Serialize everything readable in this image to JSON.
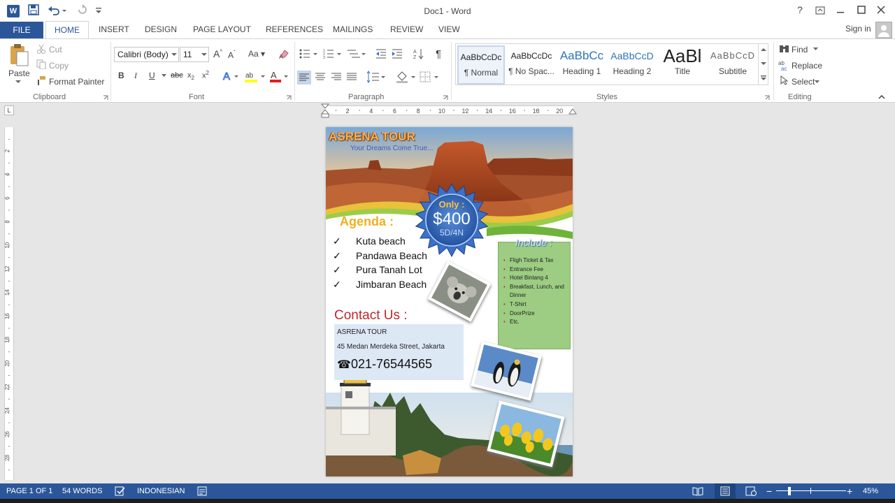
{
  "window": {
    "title": "Doc1 - Word",
    "app_icon": "W",
    "qat": {
      "save_icon": "save-icon",
      "undo_icon": "undo-icon",
      "redo_icon": "redo-icon",
      "customize_icon": "customize-icon"
    },
    "buttons": {
      "help": "?",
      "ribbon_display": "ribbon-display-icon",
      "minimize": "minimize-icon",
      "maximize": "maximize-icon",
      "close": "close-icon"
    }
  },
  "tabs": {
    "file": "FILE",
    "items": [
      "HOME",
      "INSERT",
      "DESIGN",
      "PAGE LAYOUT",
      "REFERENCES",
      "MAILINGS",
      "REVIEW",
      "VIEW"
    ],
    "active": "HOME",
    "sign_in": "Sign in"
  },
  "ribbon": {
    "clipboard": {
      "label": "Clipboard",
      "paste": "Paste",
      "cut": "Cut",
      "copy": "Copy",
      "format_painter": "Format Painter"
    },
    "font": {
      "label": "Font",
      "family": "Calibri (Body)",
      "size": "11",
      "aa": "Aa"
    },
    "paragraph": {
      "label": "Paragraph"
    },
    "styles": {
      "label": "Styles",
      "items": [
        {
          "preview": "AaBbCcDc",
          "name": "¶ Normal"
        },
        {
          "preview": "AaBbCcDc",
          "name": "¶ No Spac..."
        },
        {
          "preview": "AaBbCc",
          "name": "Heading 1"
        },
        {
          "preview": "AaBbCcD",
          "name": "Heading 2"
        },
        {
          "preview": "AaBl",
          "name": "Title"
        },
        {
          "preview": "AaBbCcD",
          "name": "Subtitle"
        }
      ]
    },
    "editing": {
      "label": "Editing",
      "find": "Find",
      "replace": "Replace",
      "select": "Select"
    }
  },
  "ruler": {
    "h_ticks": [
      "2",
      "4",
      "6",
      "8",
      "10",
      "12",
      "14",
      "16",
      "18",
      "20"
    ],
    "v_ticks": [
      "2",
      "4",
      "6",
      "8",
      "10",
      "12",
      "14",
      "16",
      "18",
      "20",
      "22",
      "24",
      "26",
      "28"
    ]
  },
  "document": {
    "title": "ASRENA TOUR",
    "tagline": "Your Dreams Come True...",
    "price_only": "Only :",
    "price": "$400",
    "duration": "5D/4N",
    "agenda_heading": "Agenda :",
    "agenda_items": [
      "Kuta beach",
      "Pandawa Beach",
      "Pura Tanah Lot",
      "Jimbaran Beach"
    ],
    "include_heading": "Include :",
    "include_items": [
      "Fligh Ticket & Tax",
      "Entrance Fee",
      "Hotel Bintang 4",
      "Breakfast, Lunch, and Dinner",
      "T-Shirt",
      "DoorPrize",
      "Etc."
    ],
    "contact_heading": "Contact Us :",
    "contact_name": "ASRENA TOUR",
    "contact_address": "45 Medan Merdeka Street, Jakarta",
    "contact_phone": "021-76544565"
  },
  "status": {
    "page": "PAGE 1 OF 1",
    "words": "54 WORDS",
    "language": "INDONESIAN",
    "zoom": "45%",
    "zoom_level_pct": 45
  },
  "colors": {
    "accent": "#2b579a",
    "agenda": "#f0b020",
    "contact": "#c0282c",
    "include_box": "#9ccd82",
    "contact_box": "#dde8f5"
  }
}
